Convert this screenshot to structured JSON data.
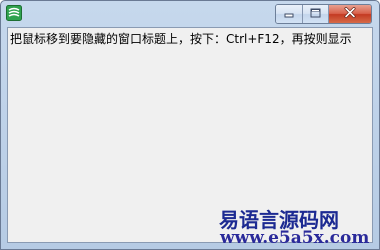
{
  "window": {
    "title": "",
    "icon": "app-icon",
    "controls": {
      "minimize": "minimize-icon",
      "maximize": "maximize-icon",
      "close": "close-icon"
    }
  },
  "content": {
    "hint_text": "把鼠标移到要隐藏的窗口标题上，按下：Ctrl+F12，再按则显示"
  },
  "watermark": {
    "site_name": "易语言源码网",
    "site_url": "www.e5a5x.com"
  },
  "colors": {
    "titlebar": "#bfd3ea",
    "client": "#f0f0f0",
    "close_button": "#c94a30",
    "watermark_text": "#1c2a92"
  }
}
